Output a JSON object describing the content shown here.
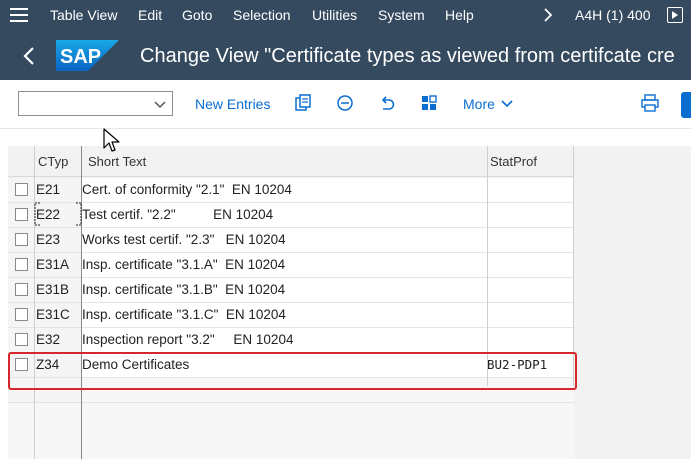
{
  "menu": {
    "items": [
      "Table View",
      "Edit",
      "Goto",
      "Selection",
      "Utilities",
      "System",
      "Help"
    ],
    "system_info": "A4H (1) 400"
  },
  "titlebar": {
    "logo_text": "SAP",
    "title": "Change View \"Certificate types as viewed from certifcate cre"
  },
  "toolbar": {
    "command_field_value": "",
    "new_entries_label": "New Entries",
    "more_label": "More"
  },
  "table": {
    "headers": {
      "ctyp": "CTyp",
      "short_text": "Short Text",
      "statprof": "StatProf"
    },
    "rows": [
      {
        "ctyp": "E21",
        "short_text": "Cert. of conformity \"2.1\"  EN 10204",
        "statprof": ""
      },
      {
        "ctyp": "E22",
        "short_text": "Test certif. \"2.2\"          EN 10204",
        "statprof": ""
      },
      {
        "ctyp": "E23",
        "short_text": "Works test certif. \"2.3\"   EN 10204",
        "statprof": ""
      },
      {
        "ctyp": "E31A",
        "short_text": "Insp. certificate \"3.1.A\"  EN 10204",
        "statprof": ""
      },
      {
        "ctyp": "E31B",
        "short_text": "Insp. certificate \"3.1.B\"  EN 10204",
        "statprof": ""
      },
      {
        "ctyp": "E31C",
        "short_text": "Insp. certificate \"3.1.C\"  EN 10204",
        "statprof": ""
      },
      {
        "ctyp": "E32",
        "short_text": "Inspection report \"3.2\"     EN 10204",
        "statprof": ""
      },
      {
        "ctyp": "Z34",
        "short_text": "Demo Certificates",
        "statprof": "BU2-PDP1"
      }
    ]
  },
  "colors": {
    "shell": "#354a5f",
    "accent": "#0a6ed1",
    "highlight": "#d9262c"
  }
}
